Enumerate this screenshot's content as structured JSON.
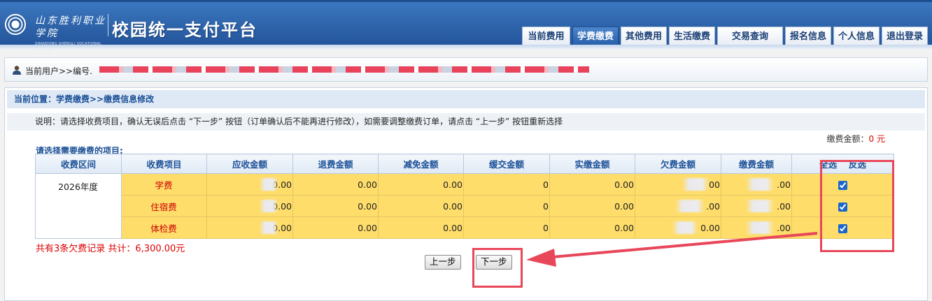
{
  "header": {
    "logo_cn": "山东胜利职业学院",
    "logo_en": "SHANDONG SHENGLI VOCATIONAL COLLEGE",
    "title": "校园统一支付平台",
    "nav": [
      {
        "label": "当前费用",
        "active": false
      },
      {
        "label": "学费缴费",
        "active": true
      },
      {
        "label": "其他费用",
        "active": false
      },
      {
        "label": "生活缴费",
        "active": false
      },
      {
        "label": "交易查询",
        "active": false
      },
      {
        "label": "报名信息",
        "active": false
      },
      {
        "label": "个人信息",
        "active": false
      },
      {
        "label": "退出登录",
        "active": false
      }
    ]
  },
  "userbar": {
    "label": "当前用户>>编号."
  },
  "main": {
    "breadcrumb": "当前位置：学费缴费>>缴费信息修改",
    "notice": "说明：请选择收费项目，确认无误后点击 “下一步” 按钮（订单确认后不能再进行修改），如需要调整缴费订单，请点击 “上一步” 按钮重新选择",
    "pay_amount_label": "缴费金额：",
    "pay_amount_value": "0 元",
    "select_tip": "请选择需要缴费的项目:",
    "columns": [
      "收费区间",
      "收费项目",
      "应收金额",
      "退费金额",
      "减免金额",
      "缓交金额",
      "实缴金额",
      "欠费金额",
      "缴费金额"
    ],
    "select_all": "全选",
    "invert": "反选",
    "period": "2026年度",
    "rows": [
      {
        "item": "学费",
        "receivable": "0.00",
        "refund": "0.00",
        "reduction": "0.00",
        "deferred": "0",
        "paid": "0.00",
        "owed": "00",
        "payment": ".00",
        "checked": true
      },
      {
        "item": "住宿费",
        "receivable": "0.00",
        "refund": "0.00",
        "reduction": "0.00",
        "deferred": "0",
        "paid": "0.00",
        "owed": ".00",
        "payment": ".00",
        "checked": true
      },
      {
        "item": "体检费",
        "receivable": "0.00",
        "refund": "0.00",
        "reduction": "0.00",
        "deferred": "0",
        "paid": "0.00",
        "owed": "0.00",
        "payment": ".00",
        "checked": true
      }
    ],
    "summary": "共有3条欠费记录  共计：6,300.00元",
    "prev_button": "上一步",
    "next_button": "下一步"
  },
  "colors": {
    "header_blue": "#2d62a8",
    "row_yellow": "#ffdd6a",
    "annotation_red": "#e8475a",
    "link_blue": "#1a4f96"
  }
}
